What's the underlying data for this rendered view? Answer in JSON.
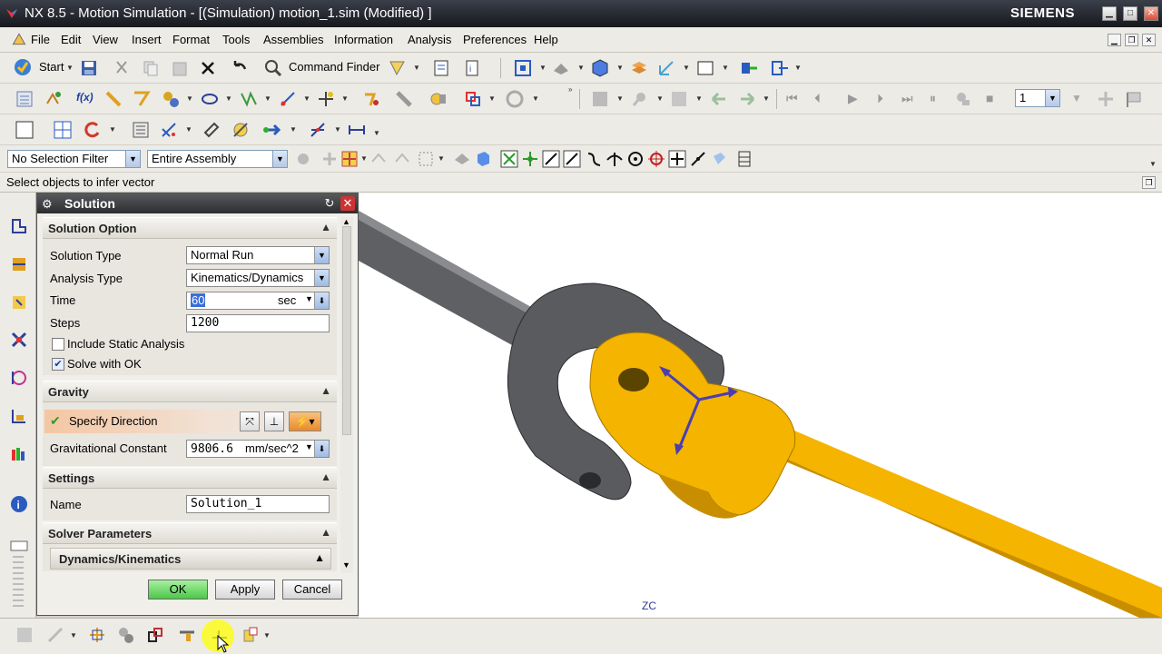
{
  "window": {
    "title": "NX 8.5 - Motion Simulation - [(Simulation) motion_1.sim (Modified) ]",
    "brand": "SIEMENS"
  },
  "menu": {
    "items": [
      "File",
      "Edit",
      "View",
      "Insert",
      "Format",
      "Tools",
      "Assemblies",
      "Information",
      "Analysis",
      "Preferences",
      "Help"
    ]
  },
  "toolbar": {
    "start_label": "Start",
    "command_finder_label": "Command Finder",
    "layer_value": "1"
  },
  "selection": {
    "filter_value": "No Selection Filter",
    "scope_value": "Entire Assembly"
  },
  "status": {
    "prompt": "Select objects to infer vector"
  },
  "dialog": {
    "title": "Solution",
    "solution_option": {
      "header": "Solution Option",
      "solution_type_label": "Solution Type",
      "solution_type_value": "Normal Run",
      "analysis_type_label": "Analysis Type",
      "analysis_type_value": "Kinematics/Dynamics",
      "time_label": "Time",
      "time_value": "60",
      "time_unit": "sec",
      "steps_label": "Steps",
      "steps_value": "1200",
      "include_static_label": "Include Static Analysis",
      "include_static_checked": false,
      "solve_with_ok_label": "Solve with OK",
      "solve_with_ok_checked": true
    },
    "gravity": {
      "header": "Gravity",
      "specify_direction_label": "Specify Direction",
      "constant_label": "Gravitational Constant",
      "constant_value": "9806.6",
      "constant_unit": "mm/sec^2"
    },
    "settings": {
      "header": "Settings",
      "name_label": "Name",
      "name_value": "Solution_1"
    },
    "solver": {
      "header": "Solver Parameters",
      "sub_header": "Dynamics/Kinematics"
    },
    "buttons": {
      "ok": "OK",
      "apply": "Apply",
      "cancel": "Cancel"
    }
  },
  "viewport": {
    "axis_label": "ZC",
    "colors": {
      "shaft_gray": "#5f6064",
      "yoke_gray": "#5a5b5f",
      "part_yellow": "#f4b400",
      "vector_blue": "#4a3fb0"
    }
  }
}
